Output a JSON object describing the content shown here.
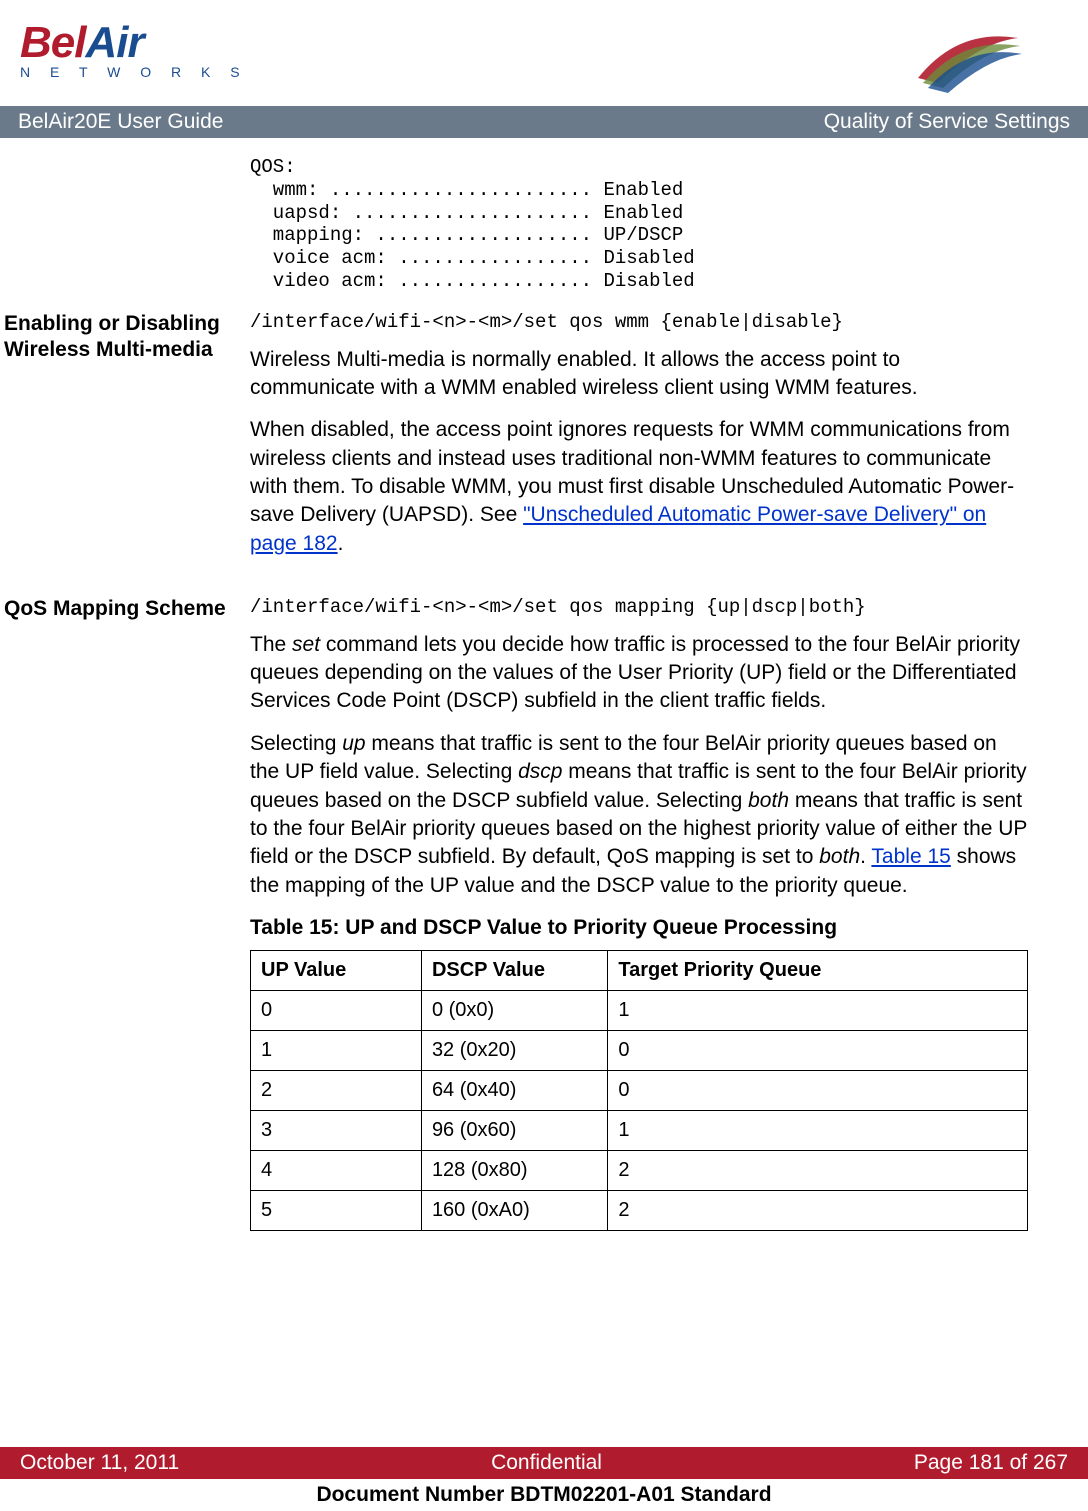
{
  "header": {
    "logo_bel": "Bel",
    "logo_air": "Air",
    "logo_networks": "N E T W O R K S"
  },
  "titlebar": {
    "left": "BelAir20E User Guide",
    "right": "Quality of Service Settings"
  },
  "qos_block": "QOS:\n  wmm: ....................... Enabled\n  uapsd: ..................... Enabled\n  mapping: ................... UP/DSCP\n  voice acm: ................. Disabled\n  video acm: ................. Disabled",
  "section1": {
    "heading": "Enabling or Disabling Wireless Multi-media",
    "cmd": "/interface/wifi-<n>-<m>/set qos wmm {enable|disable}",
    "para1": "Wireless Multi-media is normally enabled. It allows the access point to communicate with a WMM enabled wireless client using WMM features.",
    "para2_a": "When disabled, the access point ignores requests for WMM communications from wireless clients and instead uses traditional non-WMM features to communicate with them. To disable WMM, you must first disable Unscheduled Automatic Power-save Delivery (UAPSD). See ",
    "para2_link": "\"Unscheduled Automatic Power-save Delivery\" on page 182",
    "para2_b": "."
  },
  "section2": {
    "heading": "QoS Mapping Scheme",
    "cmd": "/interface/wifi-<n>-<m>/set qos mapping {up|dscp|both}",
    "para1_a": "The ",
    "para1_i1": "set",
    "para1_b": " command lets you decide how traffic is processed to the four BelAir priority queues depending on the values of the User Priority (UP) field or the Differentiated Services Code Point (DSCP) subfield in the client traffic fields.",
    "para2_a": "Selecting ",
    "para2_i1": "up",
    "para2_b": " means that traffic is sent to the four BelAir priority queues based on the UP field value. Selecting ",
    "para2_i2": "dscp",
    "para2_c": " means that traffic is sent to the four BelAir priority queues based on the DSCP subfield value. Selecting ",
    "para2_i3": "both",
    "para2_d": " means that traffic is sent to the four BelAir priority queues based on the highest priority value of either the UP field or the DSCP subfield. By default, QoS mapping is set to ",
    "para2_i4": "both",
    "para2_e": ". ",
    "para2_link": "Table 15",
    "para2_f": " shows the mapping of the UP value and the DSCP value to the priority queue."
  },
  "table": {
    "caption": "Table 15: UP and DSCP Value to Priority Queue Processing",
    "headers": [
      "UP Value",
      "DSCP Value",
      "Target Priority Queue"
    ],
    "rows": [
      [
        "0",
        "0 (0x0)",
        "1"
      ],
      [
        "1",
        "32 (0x20)",
        "0"
      ],
      [
        "2",
        "64 (0x40)",
        "0"
      ],
      [
        "3",
        "96 (0x60)",
        "1"
      ],
      [
        "4",
        "128 (0x80)",
        "2"
      ],
      [
        "5",
        "160 (0xA0)",
        "2"
      ]
    ]
  },
  "footer": {
    "date": "October 11, 2011",
    "conf": "Confidential",
    "page": "Page 181 of 267",
    "docnum": "Document Number BDTM02201-A01 Standard"
  }
}
